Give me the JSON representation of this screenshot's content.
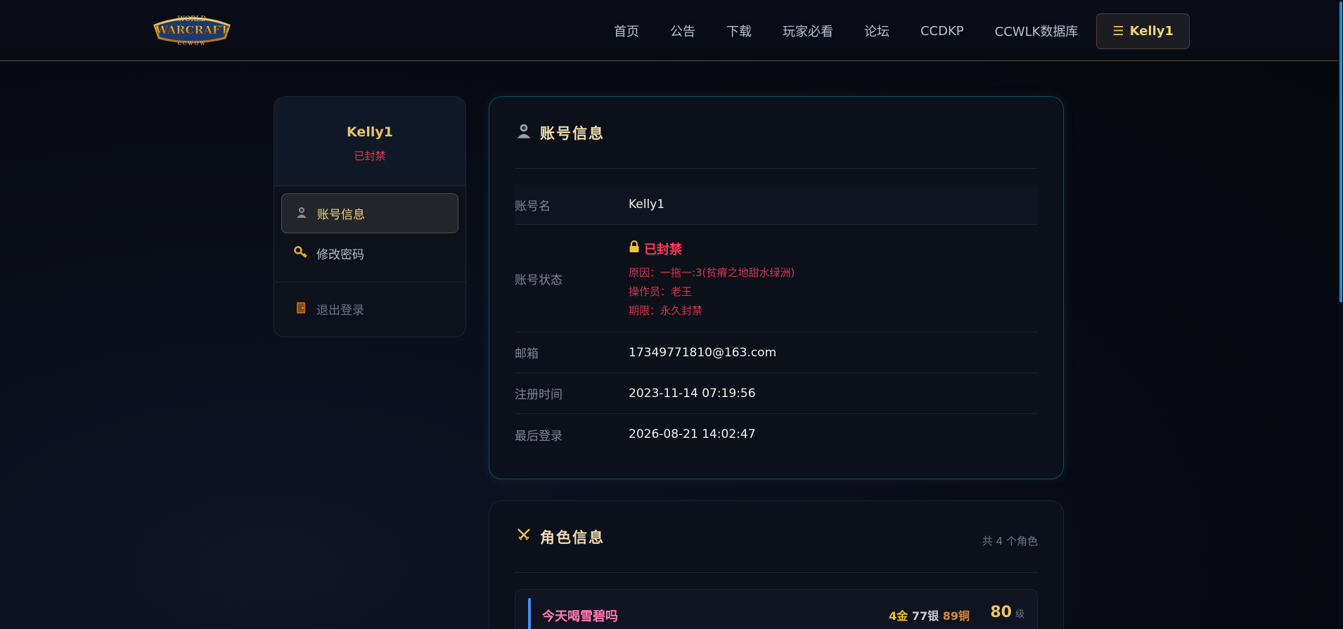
{
  "brand": {
    "logo_top": "WORLD",
    "logo_main": "WARCRAFT",
    "logo_sub": "CCWOW"
  },
  "nav": {
    "items": [
      "首页",
      "公告",
      "下载",
      "玩家必看",
      "论坛",
      "CCDKP",
      "CCWLK数据库"
    ],
    "user_label": "Kelly1"
  },
  "sidebar": {
    "username": "Kelly1",
    "status": "已封禁",
    "menu": [
      {
        "label": "账号信息",
        "icon": "user-icon"
      },
      {
        "label": "修改密码",
        "icon": "key-icon"
      }
    ],
    "logout_label": "退出登录"
  },
  "account": {
    "title": "账号信息",
    "rows": {
      "name_label": "账号名",
      "name_value": "Kelly1",
      "status_label": "账号状态",
      "status_value": "已封禁",
      "ban_reason": "原因：一拖一:3(贫瘠之地甜水绿洲)",
      "ban_operator": "操作员：老王",
      "ban_term": "期限：永久封禁",
      "email_label": "邮箱",
      "email_value": "17349771810@163.com",
      "reg_label": "注册时间",
      "reg_value": "2023-11-14 07:19:56",
      "last_label": "最后登录",
      "last_value": "2026-08-21 14:02:47"
    }
  },
  "roles": {
    "title": "角色信息",
    "count": "共 4 个角色",
    "items": [
      {
        "name": "今天喝雪碧吗",
        "gold": "4金",
        "silver": "77银",
        "copper": "89铜",
        "level": "80",
        "level_unit": "级"
      }
    ]
  },
  "colors": {
    "accent_gold": "#e9c46a",
    "ban_red": "#ff3b5c",
    "card_border": "#15485a"
  }
}
